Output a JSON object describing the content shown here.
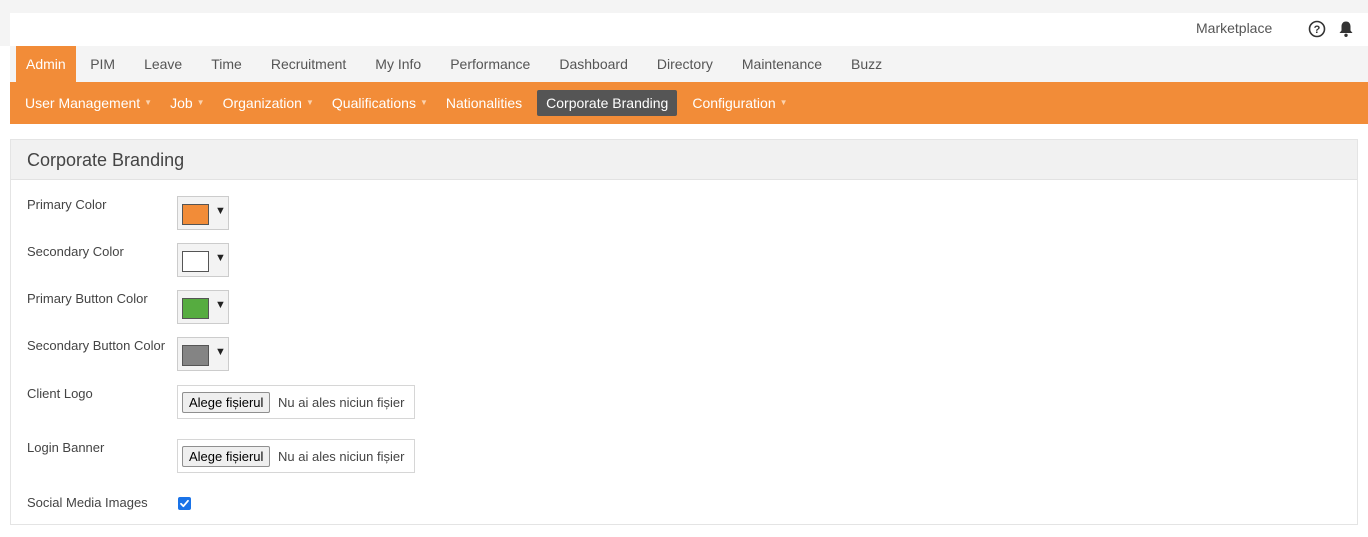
{
  "topbar": {
    "marketplace_label": "Marketplace"
  },
  "main_menu": {
    "items": [
      {
        "label": "Admin",
        "active": true
      },
      {
        "label": "PIM"
      },
      {
        "label": "Leave"
      },
      {
        "label": "Time"
      },
      {
        "label": "Recruitment"
      },
      {
        "label": "My Info"
      },
      {
        "label": "Performance"
      },
      {
        "label": "Dashboard"
      },
      {
        "label": "Directory"
      },
      {
        "label": "Maintenance"
      },
      {
        "label": "Buzz"
      }
    ]
  },
  "sub_menu": {
    "items": [
      {
        "label": "User Management",
        "dropdown": true
      },
      {
        "label": "Job",
        "dropdown": true
      },
      {
        "label": "Organization",
        "dropdown": true
      },
      {
        "label": "Qualifications",
        "dropdown": true
      },
      {
        "label": "Nationalities",
        "dropdown": false
      },
      {
        "label": "Corporate Branding",
        "dropdown": false,
        "active": true
      },
      {
        "label": "Configuration",
        "dropdown": true
      }
    ]
  },
  "panel": {
    "title": "Corporate Branding",
    "fields": {
      "primary_color": {
        "label": "Primary Color",
        "value": "#f28c38"
      },
      "secondary_color": {
        "label": "Secondary Color",
        "value": "#ffffff"
      },
      "primary_button_color": {
        "label": "Primary Button Color",
        "value": "#56ac40"
      },
      "secondary_button_color": {
        "label": "Secondary Button Color",
        "value": "#848484"
      },
      "client_logo": {
        "label": "Client Logo",
        "button": "Alege fișierul",
        "status": "Nu ai ales niciun fișier"
      },
      "login_banner": {
        "label": "Login Banner",
        "button": "Alege fișierul",
        "status": "Nu ai ales niciun fișier"
      },
      "social_media_images": {
        "label": "Social Media Images",
        "checked": true
      }
    }
  },
  "colors": {
    "brand_orange": "#f28c38",
    "active_submenu": "#555555",
    "checkbox_blue": "#1a73e8"
  }
}
